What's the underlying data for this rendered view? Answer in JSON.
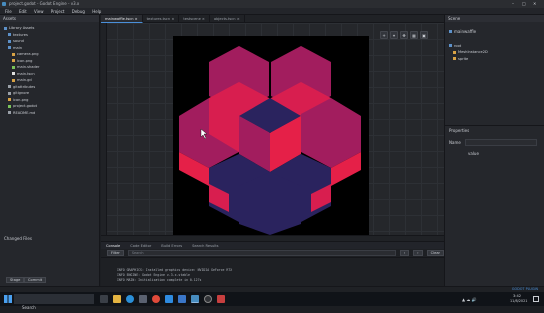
{
  "window": {
    "title": "project.godot - Godot Engine - v3.x"
  },
  "menu": [
    "File",
    "Edit",
    "View",
    "Project",
    "Debug",
    "Help"
  ],
  "filesystem": {
    "title": "Assets",
    "items": [
      {
        "label": "Library Assets",
        "indent": 1,
        "icon": "folder-icon",
        "color": "#5d91c9"
      },
      {
        "label": "textures",
        "indent": 2,
        "icon": "folder-icon",
        "color": "#5d91c9"
      },
      {
        "label": "sound",
        "indent": 2,
        "icon": "folder-icon",
        "color": "#5d91c9"
      },
      {
        "label": "main",
        "indent": 2,
        "icon": "folder-icon",
        "color": "#5d91c9"
      },
      {
        "label": "camera.png",
        "indent": 3,
        "icon": "image-icon",
        "color": "#d8a245"
      },
      {
        "label": "icon.png",
        "indent": 3,
        "icon": "image-icon",
        "color": "#d8a245"
      },
      {
        "label": "main.shader",
        "indent": 3,
        "icon": "shader-icon",
        "color": "#7ac35a"
      },
      {
        "label": "main.tscn",
        "indent": 3,
        "icon": "scene-icon",
        "color": "#e0e0e0"
      },
      {
        "label": "main.gd",
        "indent": 3,
        "icon": "script-icon",
        "color": "#d8a245"
      },
      {
        "label": "gitattributes",
        "indent": 2,
        "icon": "file-icon",
        "color": "#9aa0a8"
      },
      {
        "label": "gitignore",
        "indent": 2,
        "icon": "file-icon",
        "color": "#9aa0a8"
      },
      {
        "label": "icon.png",
        "indent": 2,
        "icon": "image-icon",
        "color": "#d8a245"
      },
      {
        "label": "project.godot",
        "indent": 2,
        "icon": "settings-icon",
        "color": "#7ac35a"
      },
      {
        "label": "README.md",
        "indent": 2,
        "icon": "file-icon",
        "color": "#9aa0a8"
      }
    ],
    "footer_label": "Changed Files",
    "buttons": [
      "Stage",
      "Commit"
    ]
  },
  "editor_tabs": [
    {
      "label": "mainwaffle.tscn",
      "active": true
    },
    {
      "label": "textures.tscn",
      "active": false
    },
    {
      "label": "testscene",
      "active": false
    },
    {
      "label": "objects.tscn",
      "active": false
    }
  ],
  "viewport": {
    "toolbar_icons": [
      "plus-icon",
      "crosshair-icon",
      "move-icon",
      "grid-icon",
      "lock-icon"
    ],
    "canvas_bg": "#000000",
    "shape_colors": {
      "top": "#a21d5e",
      "mid": "#d81e4f",
      "dark": "#2a235e",
      "light": "#e52048"
    }
  },
  "bottom_tabs": [
    {
      "label": "Console",
      "active": true
    },
    {
      "label": "Code Editor",
      "active": false
    },
    {
      "label": "Build Errors",
      "active": false
    },
    {
      "label": "Search Results",
      "active": false
    }
  ],
  "console": {
    "filter_label": "Filter",
    "search_placeholder": "Search",
    "clear_label": "Clear",
    "lines": [
      "INFO GRAPHICS: Installed graphics device: NVIDIA GeForce RTX",
      "INFO ENGINE: Godot Engine v.3.x.stable",
      "INFO MAIN: Initialization complete in 0.127s"
    ]
  },
  "scene": {
    "title": "Scene",
    "root": "mainwaffle",
    "nodes": [
      {
        "label": "root",
        "indent": 1,
        "color": "#5d91c9"
      },
      {
        "label": "MeshInstance2D",
        "indent": 2,
        "color": "#d8a245"
      },
      {
        "label": "sprite",
        "indent": 2,
        "color": "#d8a245"
      }
    ]
  },
  "inspector": {
    "title": "Properties",
    "rows": [
      {
        "label": "Name",
        "value": "value"
      }
    ]
  },
  "statusbar": {
    "right": "GODOT PLUGIN"
  },
  "taskbar": {
    "search_label": "Search",
    "clock_time": "3:42",
    "clock_date": "11/8/2021"
  }
}
